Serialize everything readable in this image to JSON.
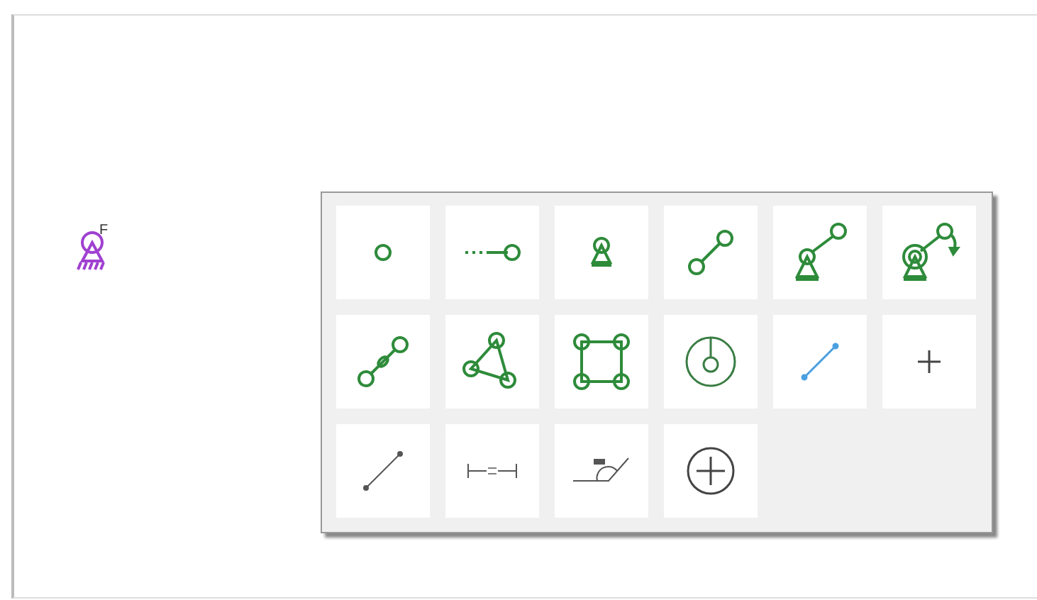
{
  "canvas": {
    "support": {
      "label": "F"
    }
  },
  "palette": {
    "tools": [
      {
        "kind": "node"
      },
      {
        "kind": "slider"
      },
      {
        "kind": "ground"
      },
      {
        "kind": "link"
      },
      {
        "kind": "crank"
      },
      {
        "kind": "driven"
      },
      {
        "kind": "slot"
      },
      {
        "kind": "triangle"
      },
      {
        "kind": "square"
      },
      {
        "kind": "wheel"
      },
      {
        "kind": "line"
      },
      {
        "kind": "point"
      },
      {
        "kind": "segment"
      },
      {
        "kind": "dimension"
      },
      {
        "kind": "angle"
      },
      {
        "kind": "add"
      }
    ]
  }
}
